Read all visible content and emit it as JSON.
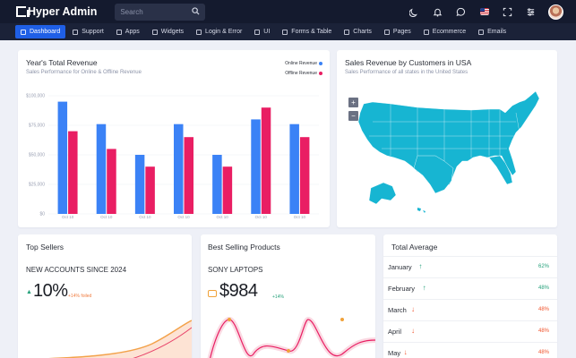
{
  "app": {
    "title": "Hyper Admin"
  },
  "search": {
    "placeholder": "Search"
  },
  "nav": [
    {
      "label": "Dashboard",
      "active": true
    },
    {
      "label": "Support"
    },
    {
      "label": "Apps"
    },
    {
      "label": "Widgets"
    },
    {
      "label": "Login & Error"
    },
    {
      "label": "UI"
    },
    {
      "label": "Forms & Table"
    },
    {
      "label": "Charts"
    },
    {
      "label": "Pages"
    },
    {
      "label": "Ecommerce"
    },
    {
      "label": "Emails"
    }
  ],
  "revenue_card": {
    "title": "Year's Total Revenue",
    "subtitle": "Sales Performance for Online & Offline Revenue"
  },
  "map_card": {
    "title": "Sales Revenue by Customers in USA",
    "subtitle": "Sales Performance of all states in the United States",
    "zoom_in": "+",
    "zoom_out": "−",
    "fill_color": "#17b5d2"
  },
  "top_sellers": {
    "title": "Top Sellers",
    "label": "NEW ACCOUNTS SINCE 2024",
    "value": "10%",
    "note": "+14% foiled",
    "accent": "#f07c3f"
  },
  "best_selling": {
    "title": "Best Selling Products",
    "label": "SONY LAPTOPS",
    "value": "$984",
    "note": "+14%",
    "accent": "#e91e63"
  },
  "total_average": {
    "title": "Total Average",
    "rows": [
      {
        "month": "January",
        "trend": "up",
        "pct": "62%"
      },
      {
        "month": "February",
        "trend": "up",
        "pct": "48%"
      },
      {
        "month": "March",
        "trend": "down",
        "pct": "48%"
      },
      {
        "month": "April",
        "trend": "down",
        "pct": "48%"
      },
      {
        "month": "May",
        "trend": "down",
        "pct": "48%"
      }
    ]
  },
  "colors": {
    "up": "#26a17b",
    "down": "#f0542d",
    "online": "#3b82f6",
    "offline": "#e91e63"
  },
  "chart_data": {
    "type": "bar",
    "categories": [
      "Oct 10",
      "Oct 10",
      "Oct 10",
      "Oct 10",
      "Oct 10",
      "Oct 10",
      "Oct 10"
    ],
    "series": [
      {
        "name": "Online Revenue",
        "color": "#3b82f6",
        "values": [
          95000,
          76000,
          50000,
          76000,
          50000,
          80000,
          76000
        ]
      },
      {
        "name": "Offline Revenue",
        "color": "#e91e63",
        "values": [
          70000,
          55000,
          40000,
          65000,
          40000,
          90000,
          65000
        ]
      }
    ],
    "y_ticks": [
      "$0",
      "$25,000",
      "$50,000",
      "$75,000",
      "$100,000"
    ],
    "ylim": [
      0,
      100000
    ],
    "grid": true,
    "legend": "top-right"
  }
}
